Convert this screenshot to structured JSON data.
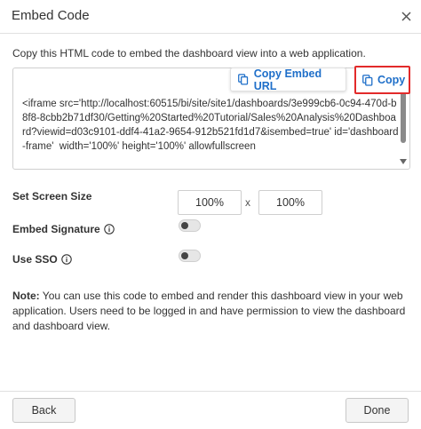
{
  "dialog": {
    "title": "Embed Code",
    "description": "Copy this HTML code to embed the dashboard view into a web application.",
    "code": "<iframe src='http://localhost:60515/bi/site/site1/dashboards/3e999cb6-0c94-470d-b8f8-8cbb2b71df30/Getting%20Started%20Tutorial/Sales%20Analysis%20Dashboard?viewid=d03c9101-ddf4-41a2-9654-912b521fd1d7&isembed=true' id='dashboard-frame'  width='100%' height='100%' allowfullscreen",
    "copy_embed_url_label": "Copy Embed URL",
    "copy_label": "Copy"
  },
  "settings": {
    "screen_size_label": "Set Screen Size",
    "width_value": "100%",
    "times_symbol": "x",
    "height_value": "100%",
    "embed_signature_label": "Embed Signature",
    "embed_signature_on": false,
    "use_sso_label": "Use SSO",
    "use_sso_on": false
  },
  "note": {
    "prefix": "Note:",
    "text": " You can use this code to embed and render this dashboard view in your web application. Users need to be logged in and have permission to view the dashboard and dashboard view."
  },
  "footer": {
    "back_label": "Back",
    "done_label": "Done"
  },
  "colors": {
    "accent": "#1f6fc9",
    "highlight_border": "#e22a2a"
  },
  "icons": [
    "close-icon",
    "copy-icon",
    "info-icon"
  ]
}
